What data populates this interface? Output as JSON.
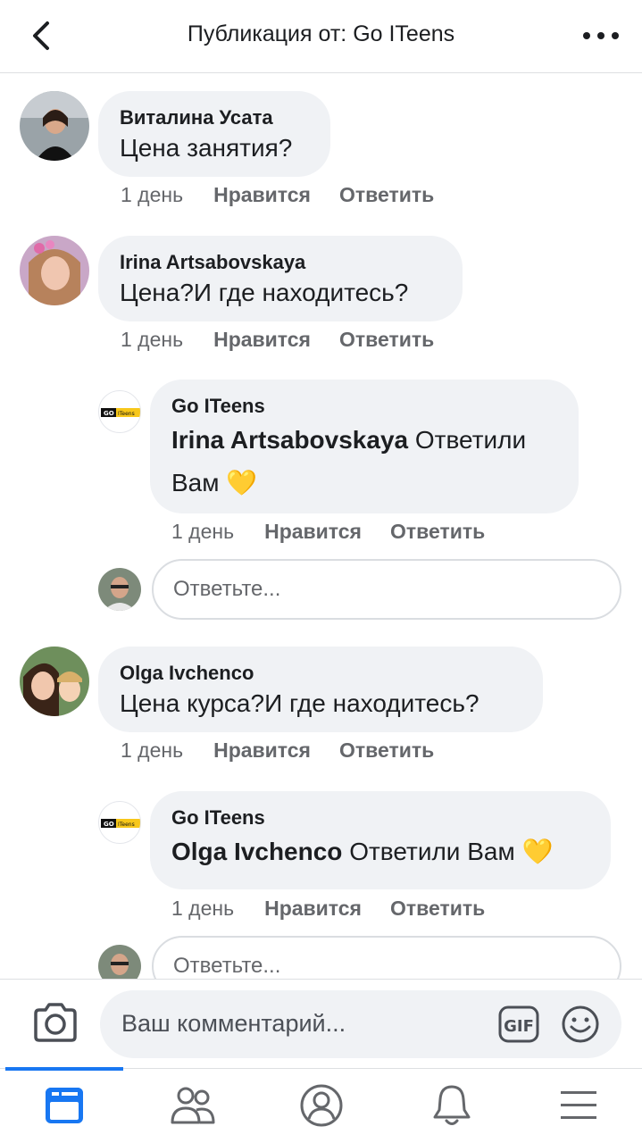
{
  "header": {
    "title": "Публикация от: Go ITeens"
  },
  "comments": [
    {
      "author": "Виталина Усата",
      "text": "Цена занятия?",
      "time": "1 день",
      "like": "Нравится",
      "reply": "Ответить"
    },
    {
      "author": "Irina Artsabovskaya",
      "text": "Цена?И где находитесь?",
      "time": "1 день",
      "like": "Нравится",
      "reply": "Ответить"
    },
    {
      "author": "Go ITeens",
      "mention": "Irina Artsabovskaya",
      "text_line1": "Ответили",
      "text_line2": "Вам 💛",
      "time": "1 день",
      "like": "Нравится",
      "reply": "Ответить"
    },
    {
      "author": "Olga Ivchenco",
      "text": "Цена курса?И где находитесь?",
      "time": "1 день",
      "like": "Нравится",
      "reply": "Ответить"
    },
    {
      "author": "Go ITeens",
      "mention": "Olga Ivchenco",
      "text": "Ответили Вам 💛",
      "time": "1 день",
      "like": "Нравится",
      "reply": "Ответить"
    }
  ],
  "reply_input": {
    "placeholder": "Ответьте..."
  },
  "composer": {
    "placeholder": "Ваш комментарий...",
    "gif_label": "GIF"
  },
  "brand_logo_text": "GO ITeens",
  "bottom_nav": [
    "news-feed-icon",
    "friends-icon",
    "profile-icon",
    "notifications-icon",
    "menu-icon"
  ],
  "colors": {
    "accent": "#1877f2",
    "bubble": "#f0f2f5",
    "meta_text": "#65676b",
    "brand_yellow": "#f7c71a"
  }
}
